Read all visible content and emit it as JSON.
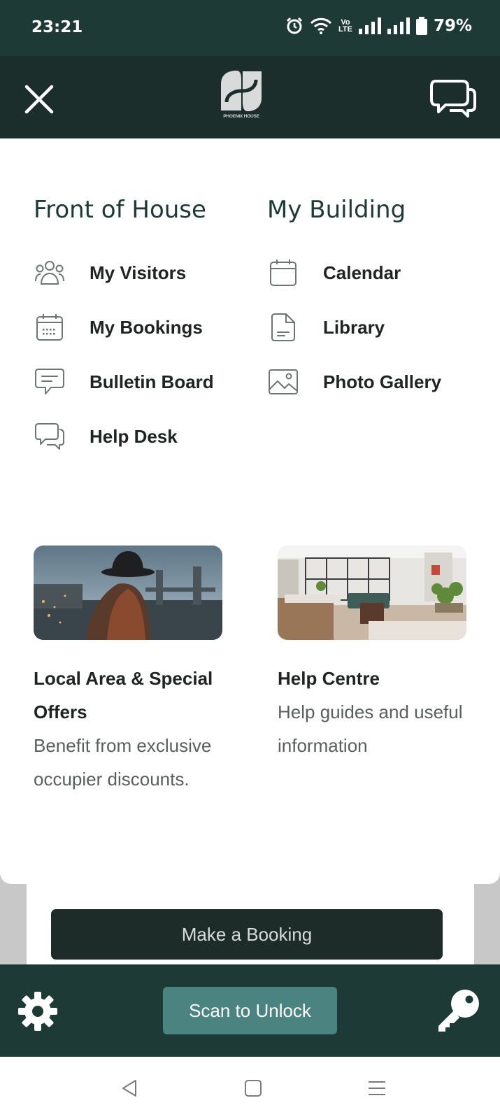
{
  "status_bar": {
    "time": "23:21",
    "volte_top": "Vo",
    "volte_bottom": "LTE",
    "battery": "79%"
  },
  "header": {
    "logo_text": "PHOENIX HOUSE"
  },
  "front_of_house": {
    "title": "Front of House",
    "items": [
      {
        "label": "My Visitors",
        "icon": "visitors-icon"
      },
      {
        "label": "My Bookings",
        "icon": "bookings-calendar-icon"
      },
      {
        "label": "Bulletin Board",
        "icon": "message-icon"
      },
      {
        "label": "Help Desk",
        "icon": "chat-icon"
      }
    ]
  },
  "my_building": {
    "title": "My Building",
    "items": [
      {
        "label": "Calendar",
        "icon": "calendar-icon"
      },
      {
        "label": "Library",
        "icon": "document-icon"
      },
      {
        "label": "Photo Gallery",
        "icon": "image-icon"
      }
    ]
  },
  "cards": [
    {
      "title": "Local Area & Special Offers",
      "description": "Benefit from exclusive occupier discounts."
    },
    {
      "title": "Help Centre",
      "description": "Help guides and useful information"
    }
  ],
  "buttons": {
    "make_booking": "Make a Booking",
    "scan_to_unlock": "Scan to Unlock"
  },
  "colors": {
    "header_bg": "#1b2e2b",
    "bottom_bar_bg": "#1e3a36",
    "accent_button": "#4a8380",
    "title_text": "#1e3a36"
  }
}
